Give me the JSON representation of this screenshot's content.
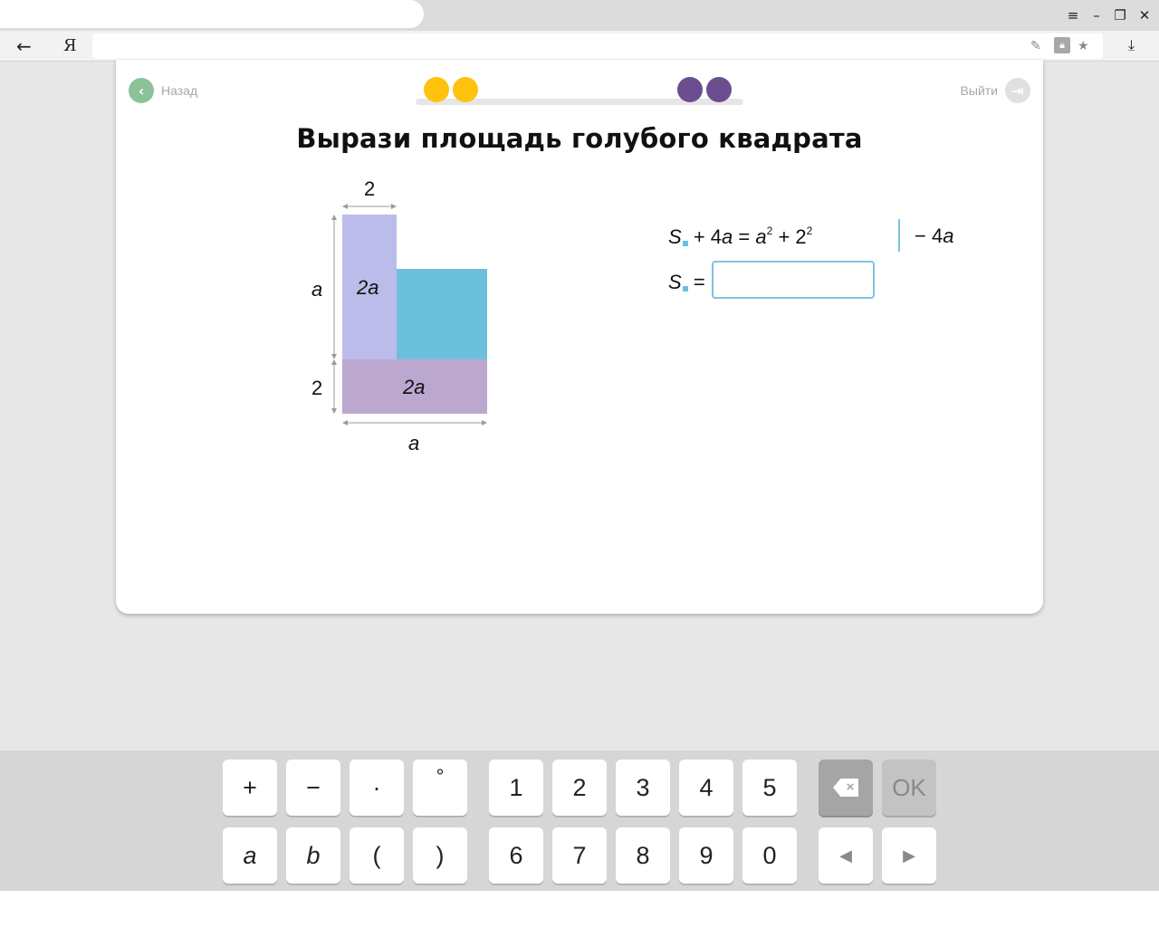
{
  "browser": {
    "logo": "Я",
    "window_controls": [
      "menu-icon",
      "minimize-icon",
      "restore-icon",
      "close-icon"
    ]
  },
  "nav": {
    "back_label": "Назад",
    "exit_label": "Выйти"
  },
  "progress": {
    "completed_color": "#ffc20e",
    "remaining_color": "#6b4e8f"
  },
  "task": {
    "title": "Вырази площадь голубого квадрата"
  },
  "figure": {
    "top_width": "2",
    "left_height": "a",
    "bottom_height": "2",
    "bottom_width": "a",
    "rect_top_label": "2a",
    "rect_bottom_label": "2a",
    "colors": {
      "lilac": "#bcbcea",
      "blue": "#6bc0dc",
      "purple": "#bca7cf"
    }
  },
  "equation": {
    "line1_s": "S",
    "line1_lhs_rest": "+ 4",
    "line1_lhs_var": "a",
    "line1_eq": "=",
    "line1_rhs_a": "a",
    "line1_rhs_a_exp": "2",
    "line1_rhs_plus": "+ 2",
    "line1_rhs_2_exp": "2",
    "operation": "− 4",
    "operation_var": "a",
    "line2_s": "S",
    "line2_eq": "=",
    "answer_value": ""
  },
  "keypad": {
    "row1_ops": [
      "+",
      "−",
      "·",
      "°"
    ],
    "row1_digits": [
      "1",
      "2",
      "3",
      "4",
      "5"
    ],
    "row2_vars": [
      "a",
      "b",
      "(",
      ")"
    ],
    "row2_digits": [
      "6",
      "7",
      "8",
      "9",
      "0"
    ],
    "ok_label": "OK",
    "left_arrow": "◀",
    "right_arrow": "▶"
  }
}
